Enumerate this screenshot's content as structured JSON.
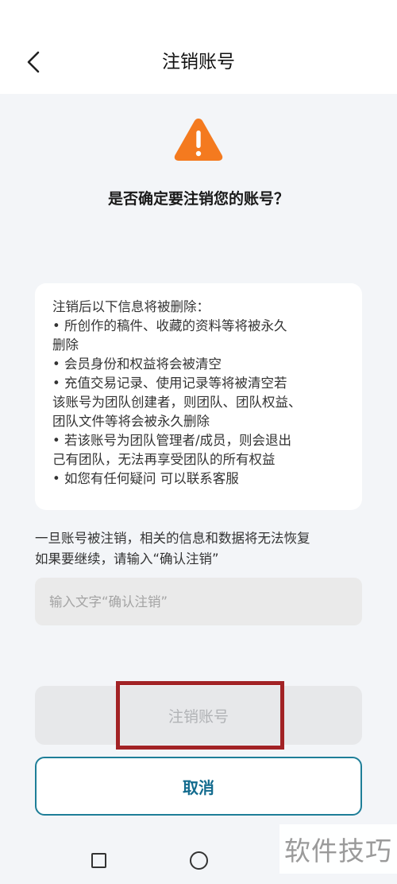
{
  "header": {
    "title": "注销账号",
    "back_icon": "chevron-left-icon"
  },
  "warning": {
    "icon": "warning-triangle-icon",
    "icon_color": "#f47a1f",
    "question": "是否确定要注销您的账号？"
  },
  "info_card": {
    "lines": [
      "注销后以下信息将被删除：",
      "•  所创作的稿件、收藏的资料等将被永久",
      "删除",
      "•  会员身份和权益将会被清空",
      "•  充值交易记录、使用记录等将被清空若",
      "该账号为团队创建者，则团队、团队权益、",
      "团队文件等将会被永久删除",
      "•  若该账号为团队管理者/成员，则会退出",
      "己有团队，无法再享受团队的所有权益",
      "•  如您有任何疑问 可以联系客服"
    ]
  },
  "notice": {
    "line1": "一旦账号被注销，相关的信息和数据将无法恢复",
    "line2": "如果要继续，请输入“确认注销”"
  },
  "confirm_input": {
    "value": "",
    "placeholder": "输入文字“确认注销”"
  },
  "buttons": {
    "delete_label": "注销账号",
    "cancel_label": "取消",
    "cancel_color": "#136b8e",
    "highlight_color": "#a22225"
  },
  "nav": {
    "recent_icon": "square-icon",
    "home_icon": "circle-icon"
  },
  "watermark": {
    "text": "软件技巧"
  }
}
